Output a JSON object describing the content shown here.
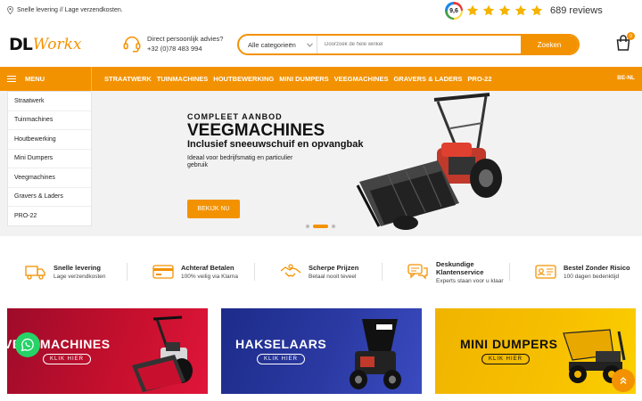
{
  "topbar": {
    "delivery_text": "Snelle levering // Lage verzendkosten.",
    "rating_score": "9,6",
    "reviews_text": "689 reviews"
  },
  "header": {
    "logo_dl": "DL",
    "logo_workx": "Workx",
    "advice_title": "Direct persoonlijk advies?",
    "advice_phone": "+32 (0)78 483 994",
    "category_select": "Alle categorieën",
    "search_placeholder": "Doorzoek de hele winkel",
    "search_button": "Zoeken",
    "cart_count": "0"
  },
  "nav": {
    "menu_label": "MENU",
    "items": [
      "STRAATWERK",
      "TUINMACHINES",
      "HOUTBEWERKING",
      "MINI DUMPERS",
      "VEEGMACHINES",
      "GRAVERS & LADERS",
      "PRO-22"
    ],
    "language": "BE-NL"
  },
  "dropdown": {
    "items": [
      "Straatwerk",
      "Tuinmachines",
      "Houtbewerking",
      "Mini Dumpers",
      "Veegmachines",
      "Gravers & Laders",
      "PRO-22"
    ]
  },
  "hero": {
    "subtitle": "COMPLEET AANBOD",
    "title": "VEEGMACHINES",
    "title2": "Inclusief sneeuwschuif en opvangbak",
    "description": "Ideaal voor bedrijfsmatig en particulier gebruik",
    "cta": "BEKIJK NU",
    "slide_count": 3,
    "active_slide": 2
  },
  "features": [
    {
      "icon": "truck-icon",
      "title": "Snelle levering",
      "subtitle": "Lage verzendkosten"
    },
    {
      "icon": "credit-card-icon",
      "title": "Achteraf Betalen",
      "subtitle": "100% veilig via Klarna"
    },
    {
      "icon": "handshake-icon",
      "title": "Scherpe Prijzen",
      "subtitle": "Betaal nooit teveel"
    },
    {
      "icon": "chat-icon",
      "title": "Deskundige Klantenservice",
      "subtitle": "Experts staan voor u klaar"
    },
    {
      "icon": "id-card-icon",
      "title": "Bestel Zonder Risico",
      "subtitle": "100 dagen bedenktijd"
    }
  ],
  "banners": [
    {
      "title": "VEEGMACHINES",
      "button": "KLIK HIER"
    },
    {
      "title": "HAKSELAARS",
      "button": "KLIK HIER"
    },
    {
      "title": "MINI DUMPERS",
      "button": "KLIK HIER"
    }
  ],
  "colors": {
    "accent": "#f39200",
    "banner_red": "#c8102e",
    "banner_blue": "#2b3aa3",
    "banner_yellow": "#f7c000",
    "whatsapp": "#25d366"
  }
}
